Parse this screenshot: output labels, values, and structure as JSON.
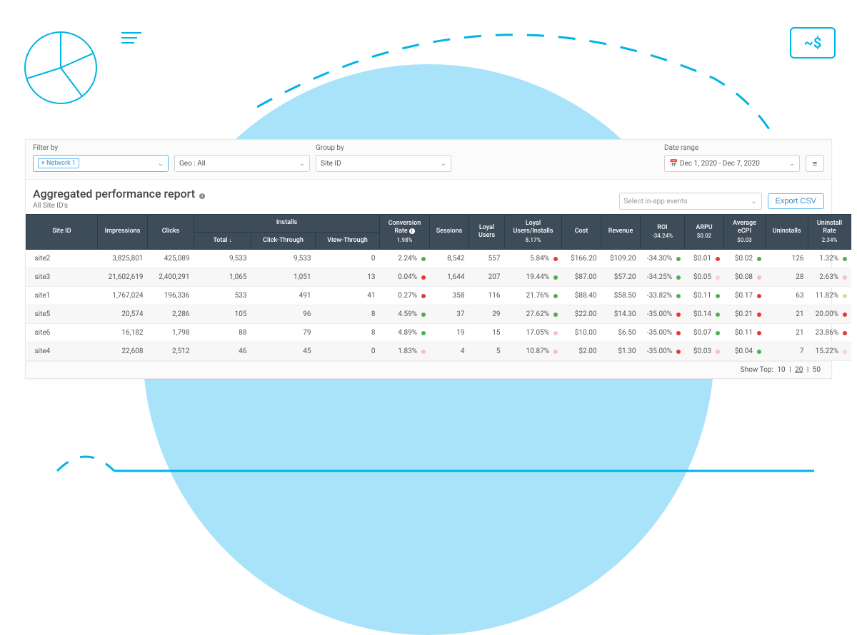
{
  "filters": {
    "filter_label": "Filter by",
    "network_tag": "× Network 1",
    "geo": "Geo : All",
    "group_label": "Group by",
    "group": "Site ID",
    "date_label": "Date range",
    "date": "Dec 1, 2020 - Dec 7, 2020"
  },
  "title": "Aggregated performance report",
  "subtitle": "All Site ID's",
  "events_placeholder": "Select in-app events",
  "export_label": "Export CSV",
  "headers": {
    "site_id": "Site ID",
    "impressions": "Impressions",
    "clicks": "Clicks",
    "installs": "Installs",
    "installs_total": "Total",
    "installs_ct": "Click-Through",
    "installs_vt": "View-Through",
    "conv": "Conversion Rate",
    "conv_sub": "1.98%",
    "sessions": "Sessions",
    "loyal": "Loyal Users",
    "loyal_inst": "Loyal Users/Installs",
    "loyal_inst_sub": "8.17%",
    "cost": "Cost",
    "revenue": "Revenue",
    "roi": "ROI",
    "roi_sub": "-34.24%",
    "arpu": "ARPU",
    "arpu_sub": "$0.02",
    "ecpi": "Average eCPI",
    "ecpi_sub": "$0.03",
    "uninstalls": "Uninstalls",
    "unin_rate": "Uninstall Rate",
    "unin_rate_sub": "2.34%"
  },
  "rows": [
    {
      "site": "site2",
      "imp": "3,825,801",
      "clk": "425,089",
      "tot": "9,533",
      "ct": "9,533",
      "vt": "0",
      "conv": "2.24%",
      "convd": "green",
      "sess": "8,542",
      "lu": "557",
      "lui": "5.84%",
      "luid": "red",
      "cost": "$166.20",
      "rev": "$109.20",
      "roi": "-34.30%",
      "roid": "green",
      "arpu": "$0.01",
      "arpud": "red",
      "ecpi": "$0.02",
      "ecpid": "green",
      "unin": "126",
      "uninr": "1.32%",
      "uninrd": "green"
    },
    {
      "site": "site3",
      "imp": "21,602,619",
      "clk": "2,400,291",
      "tot": "1,065",
      "ct": "1,051",
      "vt": "13",
      "conv": "0.04%",
      "convd": "red",
      "sess": "1,644",
      "lu": "207",
      "lui": "19.44%",
      "luid": "green",
      "cost": "$87.00",
      "rev": "$57.20",
      "roi": "-34.25%",
      "roid": "green",
      "arpu": "$0.05",
      "arpud": "lightred",
      "ecpi": "$0.08",
      "ecpid": "pink",
      "unin": "28",
      "uninr": "2.63%",
      "uninrd": "pink"
    },
    {
      "site": "site1",
      "imp": "1,767,024",
      "clk": "196,336",
      "tot": "533",
      "ct": "491",
      "vt": "41",
      "conv": "0.27%",
      "convd": "red",
      "sess": "358",
      "lu": "116",
      "lui": "21.76%",
      "luid": "green",
      "cost": "$88.40",
      "rev": "$58.50",
      "roi": "-33.82%",
      "roid": "green",
      "arpu": "$0.11",
      "arpud": "green",
      "ecpi": "$0.17",
      "ecpid": "red",
      "unin": "63",
      "uninr": "11.82%",
      "uninrd": "lightgreen"
    },
    {
      "site": "site5",
      "imp": "20,574",
      "clk": "2,286",
      "tot": "105",
      "ct": "96",
      "vt": "8",
      "conv": "4.59%",
      "convd": "green",
      "sess": "37",
      "lu": "29",
      "lui": "27.62%",
      "luid": "green",
      "cost": "$22.00",
      "rev": "$14.30",
      "roi": "-35.00%",
      "roid": "red",
      "arpu": "$0.14",
      "arpud": "green",
      "ecpi": "$0.21",
      "ecpid": "red",
      "unin": "21",
      "uninr": "20.00%",
      "uninrd": "red"
    },
    {
      "site": "site6",
      "imp": "16,182",
      "clk": "1,798",
      "tot": "88",
      "ct": "79",
      "vt": "8",
      "conv": "4.89%",
      "convd": "green",
      "sess": "19",
      "lu": "15",
      "lui": "17.05%",
      "luid": "pink",
      "cost": "$10.00",
      "rev": "$6.50",
      "roi": "-35.00%",
      "roid": "red",
      "arpu": "$0.07",
      "arpud": "green",
      "ecpi": "$0.11",
      "ecpid": "red",
      "unin": "21",
      "uninr": "23.86%",
      "uninrd": "red"
    },
    {
      "site": "site4",
      "imp": "22,608",
      "clk": "2,512",
      "tot": "46",
      "ct": "45",
      "vt": "0",
      "conv": "1.83%",
      "convd": "pink",
      "sess": "4",
      "lu": "5",
      "lui": "10.87%",
      "luid": "pink",
      "cost": "$2.00",
      "rev": "$1.30",
      "roi": "-35.00%",
      "roid": "red",
      "arpu": "$0.03",
      "arpud": "pink",
      "ecpi": "$0.04",
      "ecpid": "green",
      "unin": "7",
      "uninr": "15.22%",
      "uninrd": "lightred"
    }
  ],
  "pager": {
    "label": "Show Top:",
    "opts": [
      "10",
      "20",
      "50"
    ],
    "active": "20"
  }
}
